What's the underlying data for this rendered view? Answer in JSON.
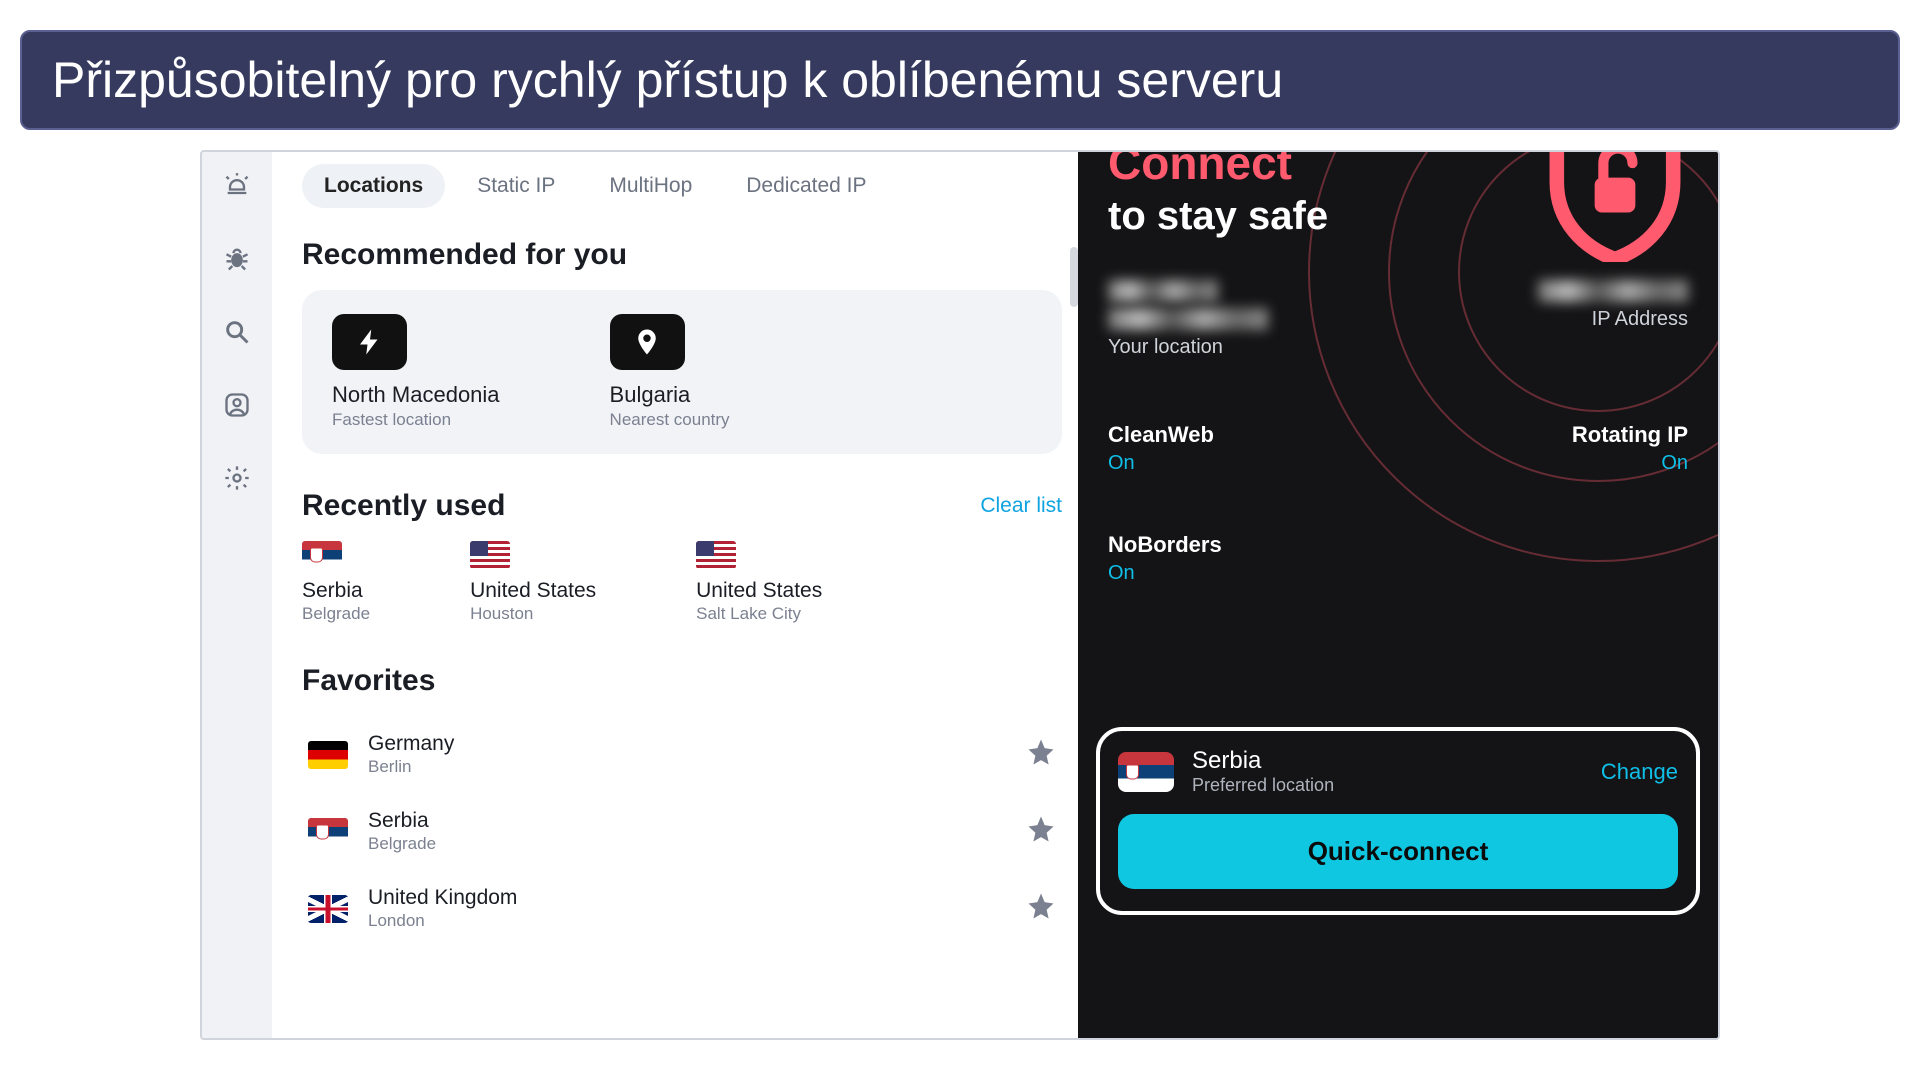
{
  "caption": "Přizpůsobitelný pro rychlý přístup k oblíbenému serveru",
  "tabs": {
    "locations": "Locations",
    "static_ip": "Static IP",
    "multihop": "MultiHop",
    "dedicated_ip": "Dedicated IP"
  },
  "recommended": {
    "heading": "Recommended for you",
    "items": [
      {
        "title": "North Macedonia",
        "subtitle": "Fastest location"
      },
      {
        "title": "Bulgaria",
        "subtitle": "Nearest country"
      }
    ]
  },
  "recently": {
    "heading": "Recently used",
    "clear": "Clear list",
    "items": [
      {
        "country": "Serbia",
        "city": "Belgrade",
        "flag": "serbia"
      },
      {
        "country": "United States",
        "city": "Houston",
        "flag": "us"
      },
      {
        "country": "United States",
        "city": "Salt Lake City",
        "flag": "us"
      }
    ]
  },
  "favorites": {
    "heading": "Favorites",
    "items": [
      {
        "country": "Germany",
        "city": "Berlin",
        "flag": "germany"
      },
      {
        "country": "Serbia",
        "city": "Belgrade",
        "flag": "serbia"
      },
      {
        "country": "United Kingdom",
        "city": "London",
        "flag": "uk"
      }
    ]
  },
  "connect": {
    "title": "Connect",
    "subtitle": "to stay safe"
  },
  "status": {
    "your_location_label": "Your location",
    "ip_address_label": "IP Address",
    "features": {
      "cleanweb": {
        "label": "CleanWeb",
        "status": "On"
      },
      "rotating_ip": {
        "label": "Rotating IP",
        "status": "On"
      },
      "noborders": {
        "label": "NoBorders",
        "status": "On"
      }
    }
  },
  "quick_connect": {
    "country": "Serbia",
    "subtitle": "Preferred location",
    "change": "Change",
    "button": "Quick-connect"
  },
  "colors": {
    "accent_red": "#ff5a6e",
    "accent_cyan": "#0fc7e0",
    "link_blue": "#0fa3e0",
    "caption_bg": "#353a5e"
  }
}
